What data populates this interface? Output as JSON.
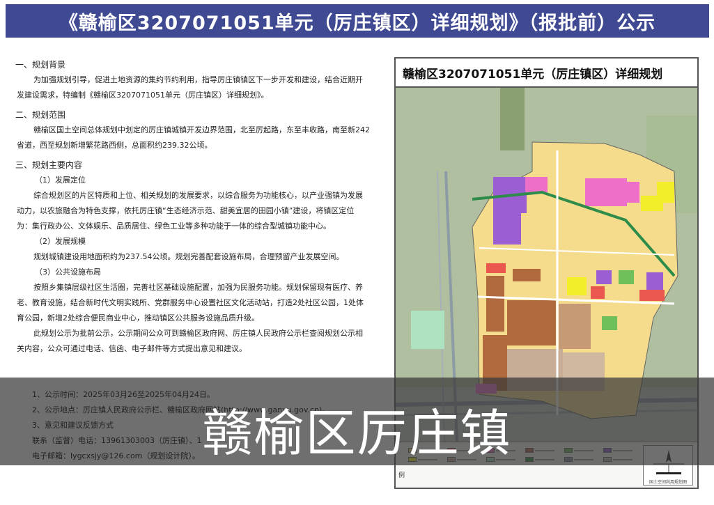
{
  "banner": {
    "title": "《赣榆区3207071051单元（厉庄镇区）详细规划》（报批前）公示"
  },
  "sections": {
    "background": {
      "heading": "一、规划背景",
      "body_1": "为加强规划引导，促进土地资源的集约节约利用，指导厉庄镇镇区下一步开发和建设，结合近期开",
      "body_2": "发建设需求，特编制《赣榆区3207071051单元（厉庄镇区）详细规划》。"
    },
    "scope": {
      "heading": "二、规划范围",
      "body_1": "赣榆区国土空间总体规划中划定的厉庄镇城镇开发边界范围，北至厉起路，东至丰收路，南至新242",
      "body_2": "省道，西至规划新增繁花路西侧，总面积约239.32公顷。"
    },
    "content": {
      "heading": "三、规划主要内容",
      "sub1_heading": "（1）发展定位",
      "sub1_body_1": "综合规划区的片区特质和上位、相关规划的发展要求，以综合服务为功能核心，以产业强镇为发展",
      "sub1_body_2": "动力，以农旅融合为特色支撑，依托厉庄镇“生态经济示范、甜美宜居的田园小镇”建设，将镇区定位",
      "sub1_body_3": "为：集行政办公、文体娱乐、品质居住、绿色工业等多种功能于一体的综合型城镇功能中心。",
      "sub2_heading": "（2）发展规模",
      "sub2_body_1": "规划城镇建设用地面积约为237.54公顷。规划完善配套设施布局，合理预留产业发展空间。",
      "sub3_heading": "（3）公共设施布局",
      "sub3_body_1": "按照乡集镇层级社区生活圈，完善社区基础设施配置，加强为民服务功能。规划保留现有医疗、养",
      "sub3_body_2": "老、教育设施，结合新时代文明实践所、党群服务中心设置社区文化活动站，打造2处社区公园，1处体",
      "sub3_body_3": "育公园，新增2处综合便民商业中心，推动镇区公共服务设施品质升级。",
      "notice_1": "此规划公示为批前公示，公示期间公众可到赣榆区政府网、厉庄镇人民政府公示栏查阅规划公示相",
      "notice_2": "关内容，公众可通过电话、信函、电子邮件等方式提出意见和建议。"
    }
  },
  "footer": {
    "line_1": "1、公示时间：2025年03月26至2025年04月24日。",
    "line_2": "2、公示地点：厉庄镇人民政府公示栏、赣榆区政府网站(http://www.ganyu.gov.cn)。",
    "line_3": "3、意见和建议反馈方式",
    "line_4": "联系（监督）电话：13961303003（厉庄镇）、1",
    "line_5": "电子邮箱：lygcxsjy@126.com（规划设计院）。"
  },
  "map": {
    "title": "赣榆区3207071051单元（厉庄镇区）详细规划",
    "legend_label": "例",
    "compass_caption": "国土空间利用规划图"
  },
  "colors": {
    "banner_bg": "#3f4a93",
    "residential": "#f5dc8c",
    "commercial": "#e9574e",
    "admin": "#ee6fc8",
    "industrial": "#b06a3d",
    "education": "#9b5fd3",
    "green": "#6fbf5a",
    "yellow_public": "#f2ee2a"
  },
  "watermark": {
    "text": "赣榆区厉庄镇"
  }
}
